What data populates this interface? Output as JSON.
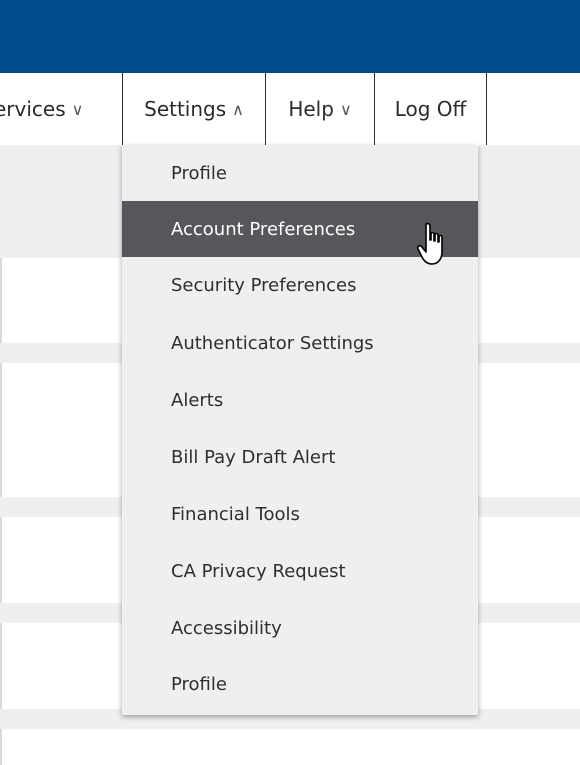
{
  "navbar": {
    "items": [
      {
        "label": "ervices",
        "chevron": "∨"
      },
      {
        "label": "Settings",
        "chevron": "∧"
      },
      {
        "label": "Help",
        "chevron": "∨"
      },
      {
        "label": "Log Off"
      }
    ]
  },
  "dropdown": {
    "items": [
      {
        "label": "Profile"
      },
      {
        "label": "Account Preferences",
        "active": true
      },
      {
        "label": "Security Preferences"
      },
      {
        "label": "Authenticator Settings"
      },
      {
        "label": "Alerts"
      },
      {
        "label": "Bill Pay Draft Alert"
      },
      {
        "label": "Financial Tools"
      },
      {
        "label": "CA Privacy Request"
      },
      {
        "label": "Accessibility"
      },
      {
        "label": "Profile"
      }
    ]
  },
  "colors": {
    "header_blue": "#004b8d",
    "menu_bg": "#efefef",
    "active_bg": "#56575b"
  }
}
